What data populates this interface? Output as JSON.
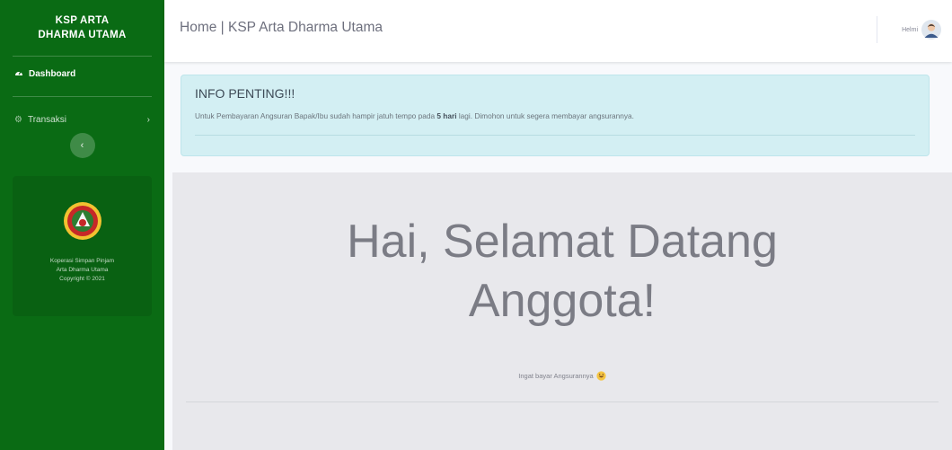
{
  "sidebar": {
    "brand_line1": "KSP ARTA",
    "brand_line2": "DHARMA UTAMA",
    "nav": {
      "dashboard": {
        "label": "Dashboard",
        "icon": "tachometer-icon"
      },
      "transaksi": {
        "label": "Transaksi",
        "icon": "cog-icon"
      }
    },
    "toggle_icon": "chevron-left-icon",
    "card": {
      "logo": "koperasi-logo",
      "line1": "Koperasi Simpan Pinjam",
      "line2": "Arta Dharma Utama",
      "line3": "Copyright © 2021"
    }
  },
  "topbar": {
    "title": "Home | KSP Arta Dharma Utama",
    "user_name": "Helmi"
  },
  "alert": {
    "heading": "INFO PENTING!!!",
    "text_before": "Untuk Pembayaran Angsuran Bapak/Ibu sudah hampir jatuh tempo pada ",
    "text_bold": "5 hari",
    "text_after": " lagi. Dimohon untuk segera membayar angsurannya."
  },
  "jumbotron": {
    "title_line1": "Hai, Selamat Datang",
    "title_line2": "Anggota!",
    "subtitle": "Ingat bayar Angsurannya"
  },
  "colors": {
    "sidebar": "#0a6b14",
    "alert_bg": "#d3eff3",
    "jumbotron_bg": "#e8e8ec"
  }
}
